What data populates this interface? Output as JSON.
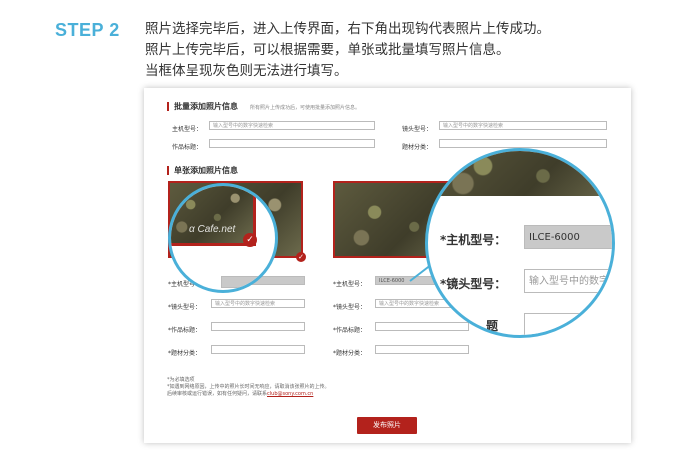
{
  "step": {
    "label": "STEP 2",
    "lines": [
      "照片选择完毕后，进入上传界面，右下角出现钩代表照片上传成功。",
      "照片上传完毕后，可以根据需要，单张或批量填写照片信息。",
      "当框体呈现灰色则无法进行填写。"
    ]
  },
  "batch": {
    "title": "批量添加照片信息",
    "note": "所有照片上传成功后，可使用批量添加照片信息。",
    "camera_label": "主机型号：",
    "camera_placeholder": "输入型号中的数字快速检索",
    "lens_label": "镜头型号：",
    "lens_placeholder": "输入型号中的数字快速检索",
    "title_label": "作品标题：",
    "subject_label": "题材分类："
  },
  "single": {
    "title": "单张添加照片信息",
    "watermark": "α Cafe.net",
    "left": {
      "camera_label": "*主机型号：",
      "camera_value": "",
      "lens_label": "*镜头型号：",
      "lens_placeholder": "输入型号中的数字快速检索",
      "title_label": "*作品标题：",
      "subject_label": "*题材分类："
    },
    "right": {
      "camera_label": "*主机型号：",
      "camera_value": "ILCE-6000",
      "lens_label": "*镜头型号：",
      "lens_placeholder": "输入型号中的数字快速检索",
      "title_label": "*作品标题：",
      "subject_label": "*题材分类："
    }
  },
  "footnote": {
    "line1": "*为必填选项",
    "line2": "*如遇到网络原因，上传中的照片长时间无响应，请取消该张照片的上传。",
    "line3_prefix": "后续审核或运行错误，如有任何疑问，请联系",
    "email": "club@sony.com.cn"
  },
  "publish_label": "发布照片",
  "zoom": {
    "camera_label": "*主机型号：",
    "camera_value": "ILCE-6000",
    "lens_label": "*镜头型号：",
    "lens_placeholder": "输入型号中的数字",
    "partial_label": "题"
  },
  "colors": {
    "accent_blue": "#4ab0d9",
    "brand_red": "#b3221c",
    "disabled_gray": "#c9c9c9"
  }
}
